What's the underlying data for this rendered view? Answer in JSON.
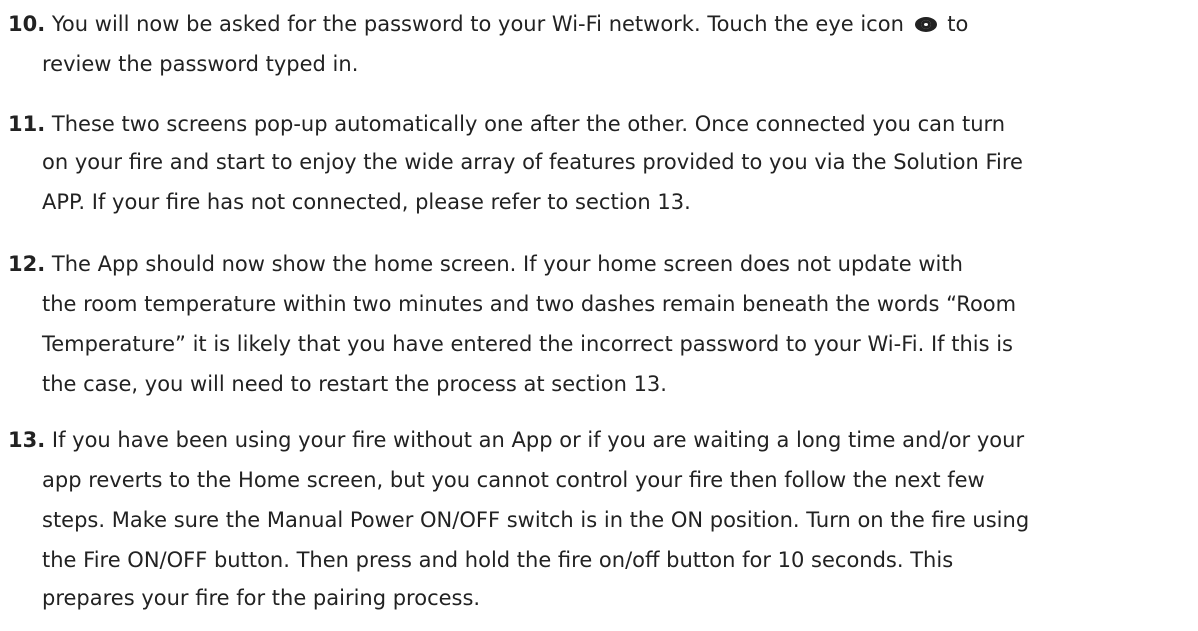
{
  "steps": [
    {
      "number": "10.",
      "lines": [
        "You will now be asked for the password to your Wi-Fi network. Touch the eye icon",
        "to",
        "review the password typed in."
      ],
      "icon": "eye-icon"
    },
    {
      "number": "11.",
      "lines": [
        "These two screens pop-up automatically one after the other.  Once connected you can turn",
        "on your fire and start to enjoy the wide array of features provided to you via the Solution Fire",
        "APP. If your fire has not connected, please refer to section 13."
      ]
    },
    {
      "number": "12.",
      "lines": [
        "The App should now show the home screen. If your home screen does not update with",
        "the room temperature within two minutes and two dashes remain beneath the words “Room",
        "Temperature” it is likely that you have entered the incorrect password to your Wi-Fi. If this is",
        "the case, you will need to restart the process at section 13."
      ]
    },
    {
      "number": "13.",
      "lines": [
        "If you have been using your fire without an App or if you are waiting a long time and/or your",
        "app reverts to the Home screen, but you cannot control your fire then follow the next few",
        "steps. Make sure the Manual Power ON/OFF switch is in the ON position. Turn on the fire using",
        "the Fire ON/OFF button. Then press and hold the fire on/off button for 10 seconds. This",
        "prepares your fire for the pairing process."
      ]
    }
  ]
}
